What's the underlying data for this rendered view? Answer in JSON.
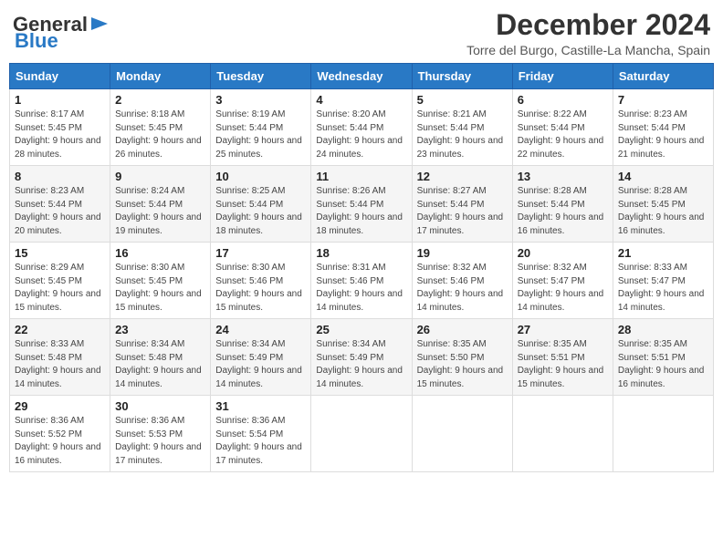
{
  "header": {
    "logo_line1": "General",
    "logo_line2": "Blue",
    "month_title": "December 2024",
    "location": "Torre del Burgo, Castille-La Mancha, Spain"
  },
  "weekdays": [
    "Sunday",
    "Monday",
    "Tuesday",
    "Wednesday",
    "Thursday",
    "Friday",
    "Saturday"
  ],
  "weeks": [
    [
      {
        "day": "1",
        "info": "Sunrise: 8:17 AM\nSunset: 5:45 PM\nDaylight: 9 hours and 28 minutes."
      },
      {
        "day": "2",
        "info": "Sunrise: 8:18 AM\nSunset: 5:45 PM\nDaylight: 9 hours and 26 minutes."
      },
      {
        "day": "3",
        "info": "Sunrise: 8:19 AM\nSunset: 5:44 PM\nDaylight: 9 hours and 25 minutes."
      },
      {
        "day": "4",
        "info": "Sunrise: 8:20 AM\nSunset: 5:44 PM\nDaylight: 9 hours and 24 minutes."
      },
      {
        "day": "5",
        "info": "Sunrise: 8:21 AM\nSunset: 5:44 PM\nDaylight: 9 hours and 23 minutes."
      },
      {
        "day": "6",
        "info": "Sunrise: 8:22 AM\nSunset: 5:44 PM\nDaylight: 9 hours and 22 minutes."
      },
      {
        "day": "7",
        "info": "Sunrise: 8:23 AM\nSunset: 5:44 PM\nDaylight: 9 hours and 21 minutes."
      }
    ],
    [
      {
        "day": "8",
        "info": "Sunrise: 8:23 AM\nSunset: 5:44 PM\nDaylight: 9 hours and 20 minutes."
      },
      {
        "day": "9",
        "info": "Sunrise: 8:24 AM\nSunset: 5:44 PM\nDaylight: 9 hours and 19 minutes."
      },
      {
        "day": "10",
        "info": "Sunrise: 8:25 AM\nSunset: 5:44 PM\nDaylight: 9 hours and 18 minutes."
      },
      {
        "day": "11",
        "info": "Sunrise: 8:26 AM\nSunset: 5:44 PM\nDaylight: 9 hours and 18 minutes."
      },
      {
        "day": "12",
        "info": "Sunrise: 8:27 AM\nSunset: 5:44 PM\nDaylight: 9 hours and 17 minutes."
      },
      {
        "day": "13",
        "info": "Sunrise: 8:28 AM\nSunset: 5:44 PM\nDaylight: 9 hours and 16 minutes."
      },
      {
        "day": "14",
        "info": "Sunrise: 8:28 AM\nSunset: 5:45 PM\nDaylight: 9 hours and 16 minutes."
      }
    ],
    [
      {
        "day": "15",
        "info": "Sunrise: 8:29 AM\nSunset: 5:45 PM\nDaylight: 9 hours and 15 minutes."
      },
      {
        "day": "16",
        "info": "Sunrise: 8:30 AM\nSunset: 5:45 PM\nDaylight: 9 hours and 15 minutes."
      },
      {
        "day": "17",
        "info": "Sunrise: 8:30 AM\nSunset: 5:46 PM\nDaylight: 9 hours and 15 minutes."
      },
      {
        "day": "18",
        "info": "Sunrise: 8:31 AM\nSunset: 5:46 PM\nDaylight: 9 hours and 14 minutes."
      },
      {
        "day": "19",
        "info": "Sunrise: 8:32 AM\nSunset: 5:46 PM\nDaylight: 9 hours and 14 minutes."
      },
      {
        "day": "20",
        "info": "Sunrise: 8:32 AM\nSunset: 5:47 PM\nDaylight: 9 hours and 14 minutes."
      },
      {
        "day": "21",
        "info": "Sunrise: 8:33 AM\nSunset: 5:47 PM\nDaylight: 9 hours and 14 minutes."
      }
    ],
    [
      {
        "day": "22",
        "info": "Sunrise: 8:33 AM\nSunset: 5:48 PM\nDaylight: 9 hours and 14 minutes."
      },
      {
        "day": "23",
        "info": "Sunrise: 8:34 AM\nSunset: 5:48 PM\nDaylight: 9 hours and 14 minutes."
      },
      {
        "day": "24",
        "info": "Sunrise: 8:34 AM\nSunset: 5:49 PM\nDaylight: 9 hours and 14 minutes."
      },
      {
        "day": "25",
        "info": "Sunrise: 8:34 AM\nSunset: 5:49 PM\nDaylight: 9 hours and 14 minutes."
      },
      {
        "day": "26",
        "info": "Sunrise: 8:35 AM\nSunset: 5:50 PM\nDaylight: 9 hours and 15 minutes."
      },
      {
        "day": "27",
        "info": "Sunrise: 8:35 AM\nSunset: 5:51 PM\nDaylight: 9 hours and 15 minutes."
      },
      {
        "day": "28",
        "info": "Sunrise: 8:35 AM\nSunset: 5:51 PM\nDaylight: 9 hours and 16 minutes."
      }
    ],
    [
      {
        "day": "29",
        "info": "Sunrise: 8:36 AM\nSunset: 5:52 PM\nDaylight: 9 hours and 16 minutes."
      },
      {
        "day": "30",
        "info": "Sunrise: 8:36 AM\nSunset: 5:53 PM\nDaylight: 9 hours and 17 minutes."
      },
      {
        "day": "31",
        "info": "Sunrise: 8:36 AM\nSunset: 5:54 PM\nDaylight: 9 hours and 17 minutes."
      },
      null,
      null,
      null,
      null
    ]
  ]
}
